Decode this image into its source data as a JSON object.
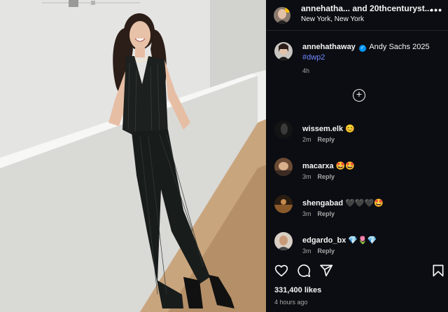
{
  "header": {
    "author_names": "annehatha... and 20thcenturyst...",
    "location": "New York, New York",
    "more_label": "•••"
  },
  "caption": {
    "username": "annehathaway",
    "verified_mark": "✓",
    "text": "Andy Sachs 2025",
    "hashtag": "#dwp2",
    "time": "4h"
  },
  "load_more_label": "+",
  "comments": [
    {
      "username": "wissem.elk",
      "emojis": "😊",
      "time": "2m",
      "reply": "Reply"
    },
    {
      "username": "macarxa",
      "emojis": "🤩🤩",
      "time": "3m",
      "reply": "Reply"
    },
    {
      "username": "shengabad",
      "emojis": "🖤🖤🖤🤩",
      "time": "3m",
      "reply": "Reply"
    },
    {
      "username": "edgardo_bx",
      "emojis": "💎🌷💎",
      "time": "3m",
      "reply": "Reply"
    }
  ],
  "likes": "331,400 likes",
  "posted_ago": "4 hours ago",
  "icons": [
    "heart-icon",
    "comment-icon",
    "share-icon",
    "bookmark-icon",
    "add-circle-icon",
    "verified-badge-icon"
  ],
  "colors": {
    "panel_bg": "#0b0d12",
    "link": "#6f86ff",
    "muted": "#a8a8a8",
    "verified": "#0095f6"
  }
}
